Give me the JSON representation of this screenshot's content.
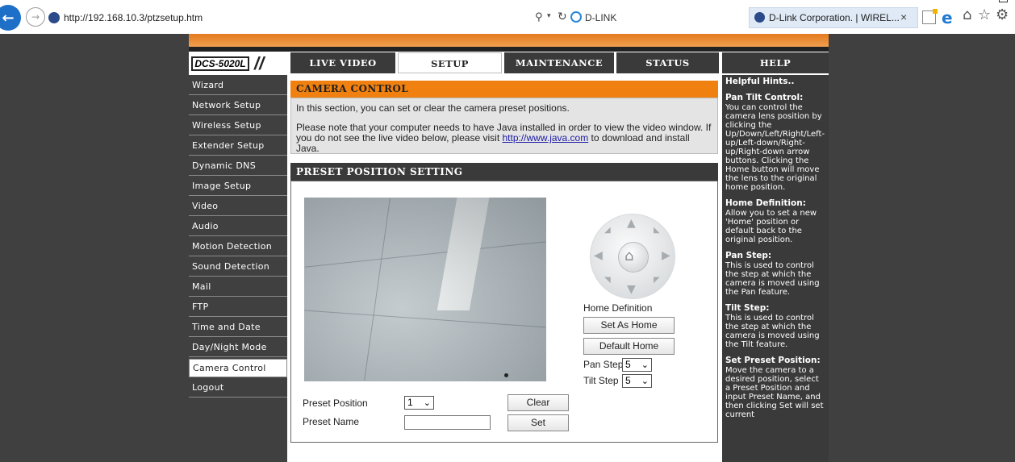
{
  "browser": {
    "url": "http://192.168.10.3/ptzsetup.htm",
    "tab_dlink": "D-LINK",
    "active_tab_title": "D-Link Corporation. | WIREL..."
  },
  "header": {
    "logo_text": "DCS-5020L",
    "tabs": [
      "LIVE VIDEO",
      "SETUP",
      "MAINTENANCE",
      "STATUS",
      "HELP"
    ],
    "active_tab": "SETUP"
  },
  "sidebar": {
    "items": [
      "Wizard",
      "Network Setup",
      "Wireless Setup",
      "Extender Setup",
      "Dynamic DNS",
      "Image Setup",
      "Video",
      "Audio",
      "Motion Detection",
      "Sound Detection",
      "Mail",
      "FTP",
      "Time and Date",
      "Day/Night Mode",
      "Camera Control",
      "Logout"
    ],
    "active": "Camera Control"
  },
  "camera_control": {
    "title": "CAMERA CONTROL",
    "line1": "In this section, you can set or clear the camera preset positions.",
    "line2_a": "Please note that your computer needs to have Java installed in order to view the video window. If you do not see the live video below, please visit ",
    "link": "http://www.java.com",
    "line2_b": " to download and install Java."
  },
  "preset": {
    "title": "PRESET POSITION SETTING",
    "home_definition": "Home Definition",
    "set_as_home": "Set As Home",
    "default_home": "Default Home",
    "pan_step_label": "Pan Step",
    "pan_step_value": "5",
    "tilt_step_label": "Tilt Step",
    "tilt_step_value": "5",
    "preset_position_label": "Preset Position",
    "preset_position_value": "1",
    "preset_name_label": "Preset Name",
    "preset_name_value": "",
    "clear_button": "Clear",
    "set_button": "Set"
  },
  "help": {
    "title": "Helpful Hints..",
    "sections": [
      {
        "heading": "Pan Tilt Control:",
        "text": "You can control the camera lens position by clicking the Up/Down/Left/Right/Left-up/Left-down/Right-up/Right-down arrow buttons. Clicking the Home button will move the lens to the original home position."
      },
      {
        "heading": "Home Definition:",
        "text": "Allow you to set a new 'Home' position or default back to the original position."
      },
      {
        "heading": "Pan Step:",
        "text": "This is used to control the step at which the camera is moved using the Pan feature."
      },
      {
        "heading": "Tilt Step:",
        "text": "This is used to control the step at which the camera is moved using the Tilt feature."
      },
      {
        "heading": "Set Preset Position:",
        "text": "Move the camera to a desired position, select a Preset Position and input Preset Name, and then clicking Set will set current"
      }
    ]
  },
  "colors": {
    "accent_orange": "#f08010",
    "dark_nav": "#3a3a3a"
  }
}
